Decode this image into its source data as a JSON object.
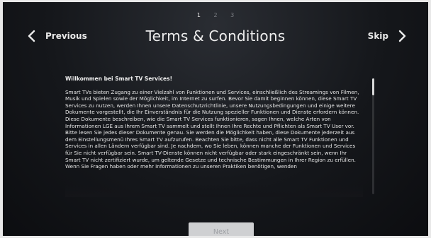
{
  "pager": {
    "steps": [
      "1",
      "2",
      "3"
    ],
    "active_step": "1"
  },
  "header": {
    "previous_label": "Previous",
    "title": "Terms & Conditions",
    "skip_label": "Skip"
  },
  "content": {
    "heading": "Willkommen bei Smart TV Services!",
    "body": "Smart TVs bieten Zugang zu einer Vielzahl von Funktionen und Services, einschließlich des Streamings von Filmen, Musik und Spielen sowie der Möglichkeit, im Internet zu surfen. Bevor Sie damit beginnen können, diese Smart TV Services zu nutzen, werden Ihnen unsere Datenschutzrichtlinie, unsere Nutzungsbedingungen und einige weitere Dokumente vorgestellt, die Ihr Einverständnis für die Nutzung spezieller Funktionen und Dienste erfordern können. Diese Dokumente beschreiben, wie die Smart TV Services funktionieren, sagen Ihnen, welche Arten von Informationen LGE aus Ihrem Smart TV sammelt und stellt Ihnen Ihre Rechte und Pflichten als Smart TV User vor. Bitte lesen Sie jedes dieser Dokumente genau. Sie werden die Möglichkeit haben, diese Dokumente jederzeit aus dem Einstellungsmenü Ihres Smart TV aufzurufen. Beachten Sie bitte, dass nicht alle Smart TV Funktionen und Services in allen Ländern verfügbar sind. Je nachdem, wo Sie leben, können manche der Funktionen und Services für Sie nicht verfügbar sein. Smart TV-Dienste können nicht verfügbar oder stark eingeschränkt sein, wenn Ihr Smart TV nicht zertifiziert wurde, um geltende Gesetze und technische Bestimmungen in Ihrer Region zu erfüllen. Wenn Sie Fragen haben oder mehr Informationen zu unseren Praktiken benötigen, wenden"
  },
  "scroll": {
    "position_fraction": 0.0
  },
  "footer": {
    "next_label": "Next"
  }
}
